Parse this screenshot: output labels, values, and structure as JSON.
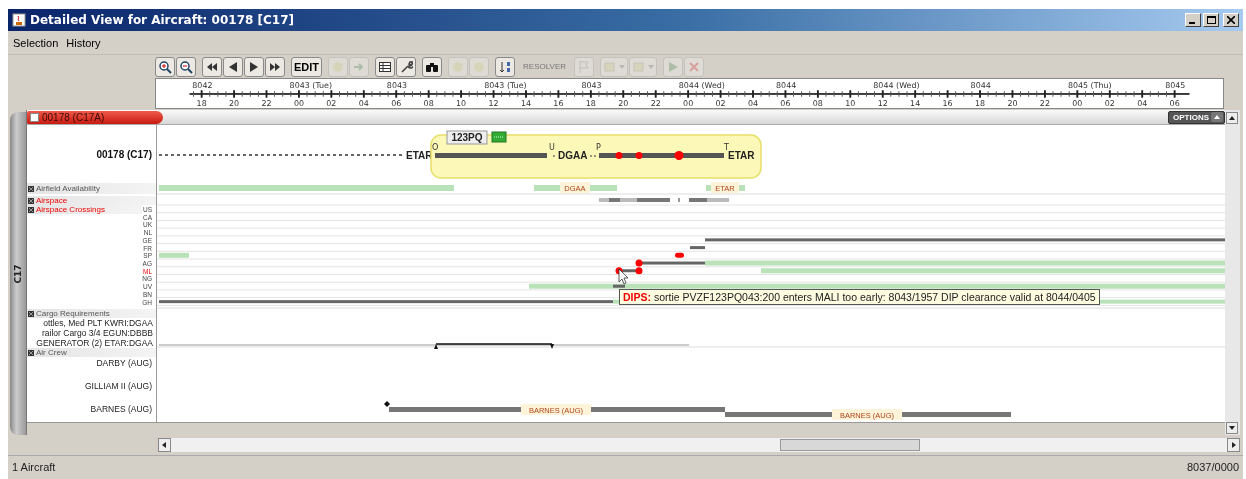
{
  "window": {
    "title": "Detailed View for Aircraft: 00178 [C17]"
  },
  "menu": [
    {
      "label": "Selection"
    },
    {
      "label": "History"
    }
  ],
  "toolbar": [
    {
      "kind": "icon",
      "disabled": false
    },
    {
      "kind": "icon",
      "disabled": false
    },
    {
      "kind": "icon",
      "disabled": false
    },
    {
      "kind": "icon",
      "disabled": false
    },
    {
      "kind": "icon",
      "disabled": false
    },
    {
      "kind": "icon",
      "disabled": false
    },
    {
      "kind": "text",
      "label": "EDIT",
      "disabled": false
    },
    {
      "kind": "icon",
      "disabled": true
    },
    {
      "kind": "icon",
      "disabled": true
    },
    {
      "kind": "icon",
      "disabled": false
    },
    {
      "kind": "icon",
      "disabled": false
    },
    {
      "kind": "icon",
      "disabled": false
    },
    {
      "kind": "icon",
      "disabled": true
    },
    {
      "kind": "icon",
      "disabled": true
    },
    {
      "kind": "icon",
      "disabled": false
    },
    {
      "kind": "text",
      "label": "RESOLVER",
      "disabled": true
    },
    {
      "kind": "icon",
      "disabled": true
    },
    {
      "kind": "dropdown",
      "disabled": true
    },
    {
      "kind": "dropdown",
      "disabled": true
    },
    {
      "kind": "icon",
      "disabled": true
    },
    {
      "kind": "icon",
      "disabled": true
    }
  ],
  "timeline": {
    "days": [
      "8042",
      "8043 (Tue)",
      "8043",
      "8043 (Tue)",
      "8043",
      "8044 (Wed)",
      "8044",
      "8044 (Wed)",
      "8044",
      "8045 (Thu)",
      "8045"
    ],
    "hours": [
      "18",
      "20",
      "22",
      "00",
      "02",
      "04",
      "06",
      "08",
      "10",
      "12",
      "14",
      "16",
      "18",
      "20",
      "22",
      "00",
      "02",
      "04",
      "06",
      "08",
      "10",
      "12",
      "14",
      "16",
      "18",
      "20",
      "22",
      "00",
      "02",
      "04",
      "06"
    ]
  },
  "panel": {
    "tab": {
      "label": "00178 (C17A)",
      "checked": false
    },
    "options": "OPTIONS",
    "side_tab": "C17",
    "aircraft": "00178 (C17)",
    "sections": [
      {
        "kind": "header",
        "title": "Airfield Availability",
        "alert": false
      },
      {
        "kind": "header",
        "title": "Airspace",
        "alert": true
      },
      {
        "kind": "countries",
        "title": "Airspace Crossings",
        "alert": true,
        "countries": [
          {
            "code": "US",
            "alert": false
          },
          {
            "code": "CA",
            "alert": false
          },
          {
            "code": "UK",
            "alert": false
          },
          {
            "code": "NL",
            "alert": false
          },
          {
            "code": "GE",
            "alert": false
          },
          {
            "code": "FR",
            "alert": false
          },
          {
            "code": "SP",
            "alert": false
          },
          {
            "code": "AG",
            "alert": false
          },
          {
            "code": "ML",
            "alert": true
          },
          {
            "code": "NG",
            "alert": false
          },
          {
            "code": "UV",
            "alert": false
          },
          {
            "code": "BN",
            "alert": false
          },
          {
            "code": "GH",
            "alert": false
          }
        ]
      },
      {
        "kind": "lines",
        "title": "Cargo Requirements",
        "alert": false,
        "items": [
          "ottles, Med PLT  KWRI:DGAA",
          "railor Cargo 3/4  EGUN:DBBB",
          "GENERATOR (2)  ETAR:DGAA"
        ]
      },
      {
        "kind": "crew",
        "title": "Air Crew",
        "alert": false,
        "items": [
          "DARBY (AUG)",
          "GILLIAM II (AUG)",
          "BARNES (AUG)"
        ]
      }
    ]
  },
  "gantt": {
    "sortie": "123PQ",
    "origin": "ETAR",
    "stop": "DGAA",
    "destination": "ETAR",
    "markers": [
      "O",
      "U",
      "P",
      "T"
    ],
    "airfield_labels": [
      "DGAA",
      "ETAR"
    ],
    "crew_labels": [
      "BARNES (AUG)",
      "BARNES (AUG)"
    ]
  },
  "tooltip": "**DIPS:** sortie PVZF123PQ043:200 enters MALI too early: 8043/1957 DIP clearance valid at 8044/0405",
  "status_bar": {
    "left": "1 Aircraft",
    "right": "8037/0000"
  }
}
